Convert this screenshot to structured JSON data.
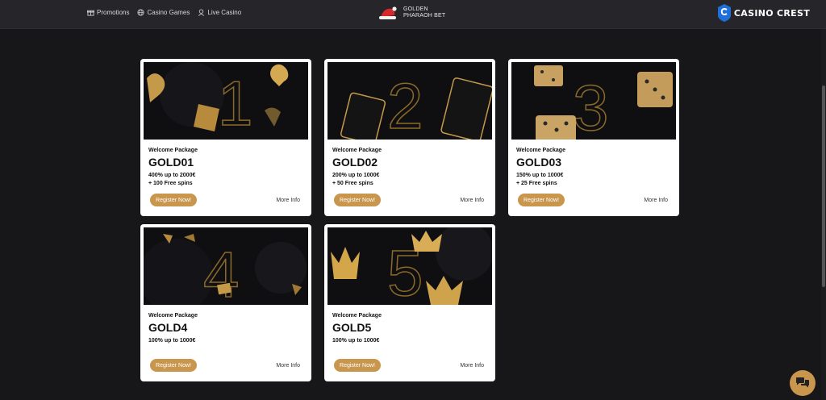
{
  "nav": {
    "items": [
      {
        "label": "Promotions",
        "icon": "gift-icon"
      },
      {
        "label": "Casino Games",
        "icon": "globe-icon"
      },
      {
        "label": "Live Casino",
        "icon": "dealer-icon"
      }
    ]
  },
  "brand": {
    "name": "GOLDEN PHARAOH BET"
  },
  "crest": {
    "name": "CASINO CREST"
  },
  "colors": {
    "accent": "#c9964e",
    "background": "#17171a",
    "topbar": "#26262a"
  },
  "cards": [
    {
      "subtitle": "Welcome Package",
      "code": "GOLD01",
      "offer_line1": "400% up to 2000€",
      "offer_line2": "+ 100 Free spins",
      "register_label": "Register Now!",
      "more_label": "More Info",
      "numeral": "1"
    },
    {
      "subtitle": "Welcome Package",
      "code": "GOLD02",
      "offer_line1": "200% up to 1000€",
      "offer_line2": "+ 50 Free spins",
      "register_label": "Register Now!",
      "more_label": "More Info",
      "numeral": "2"
    },
    {
      "subtitle": "Welcome Package",
      "code": "GOLD03",
      "offer_line1": "150% up to 1000€",
      "offer_line2": "+ 25 Free spins",
      "register_label": "Register Now!",
      "more_label": "More Info",
      "numeral": "3"
    },
    {
      "subtitle": "Welcome Package",
      "code": "GOLD4",
      "offer_line1": "100% up to 1000€",
      "offer_line2": "",
      "register_label": "Register Now!",
      "more_label": "More Info",
      "numeral": "4"
    },
    {
      "subtitle": "Welcome Package",
      "code": "GOLD5",
      "offer_line1": "100% up to 1000€",
      "offer_line2": "",
      "register_label": "Register Now!",
      "more_label": "More Info",
      "numeral": "5"
    }
  ]
}
